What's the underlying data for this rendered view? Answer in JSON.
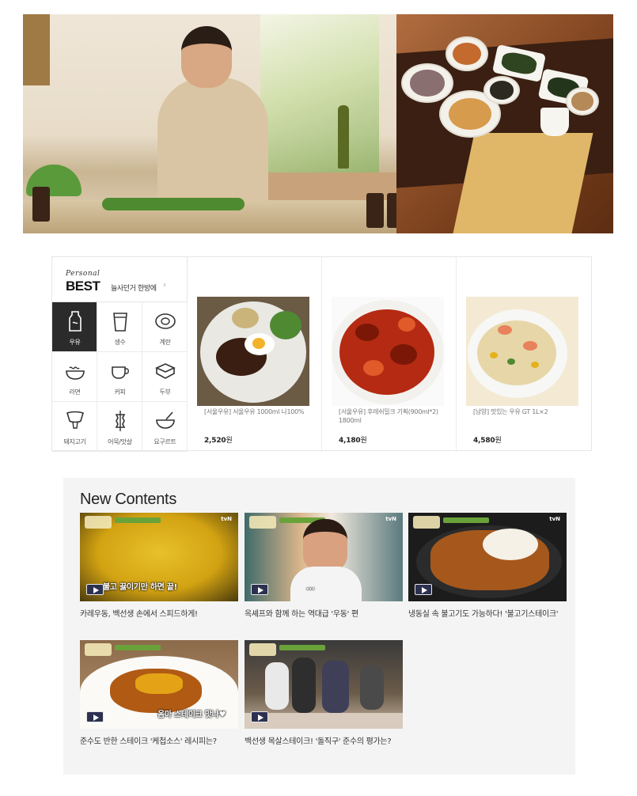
{
  "hero": {
    "scenes": [
      "chef-kitchen-scene",
      "korean-table-setting"
    ]
  },
  "best": {
    "personal": "Personal",
    "title": "BEST",
    "subtitle": "늘사던거 한방에",
    "categories": [
      {
        "label": "우유",
        "icon": "milk-icon",
        "active": true
      },
      {
        "label": "생수",
        "icon": "water-cup-icon",
        "active": false
      },
      {
        "label": "계란",
        "icon": "egg-icon",
        "active": false
      },
      {
        "label": "라면",
        "icon": "ramen-bowl-icon",
        "active": false
      },
      {
        "label": "커피",
        "icon": "coffee-cup-icon",
        "active": false
      },
      {
        "label": "두부",
        "icon": "tofu-icon",
        "active": false
      },
      {
        "label": "돼지고기",
        "icon": "pork-icon",
        "active": false
      },
      {
        "label": "어묵/맛살",
        "icon": "fishcake-icon",
        "active": false
      },
      {
        "label": "요구르트",
        "icon": "yogurt-icon",
        "active": false
      }
    ],
    "products": [
      {
        "name": "[서울우유] 서울우유 1000ml 나100%",
        "price": "2,520",
        "unit": "원",
        "image": "steak-plate"
      },
      {
        "name": "[서울우유] 후레쉬밀크 기획(900ml*2) 1800ml",
        "price": "4,180",
        "unit": "원",
        "image": "spicy-octopus"
      },
      {
        "name": "[남양] 맛있는 우유 GT 1L×2",
        "price": "4,580",
        "unit": "원",
        "image": "fried-rice"
      }
    ]
  },
  "contents": {
    "title": "New Contents",
    "videos": [
      {
        "title": "카레우동, 백선생 손에서 스피드하게!",
        "caption": "불고 끓이기만 하면 끝!",
        "logo": "tvN"
      },
      {
        "title": "옥셰프와 함께 하는 역대급 '우동' 편",
        "caption": "...",
        "logo": "tvN"
      },
      {
        "title": "냉동실 속 불고기도 가능하다! '불고기스테이크'",
        "caption": "",
        "logo": "tvN"
      },
      {
        "title": "준수도 반한 스테이크 '케첩소스' 레시피는?",
        "caption": "옴마 스테이크 맛나♥",
        "logo": ""
      },
      {
        "title": "백선생 목살스테이크! '돌직구' 준수의 평가는?",
        "caption": "",
        "logo": ""
      }
    ]
  },
  "colors": {
    "active_category": "#2b2b2b",
    "panel_bg": "#f4f4f4",
    "play_button": "#2c3150"
  }
}
